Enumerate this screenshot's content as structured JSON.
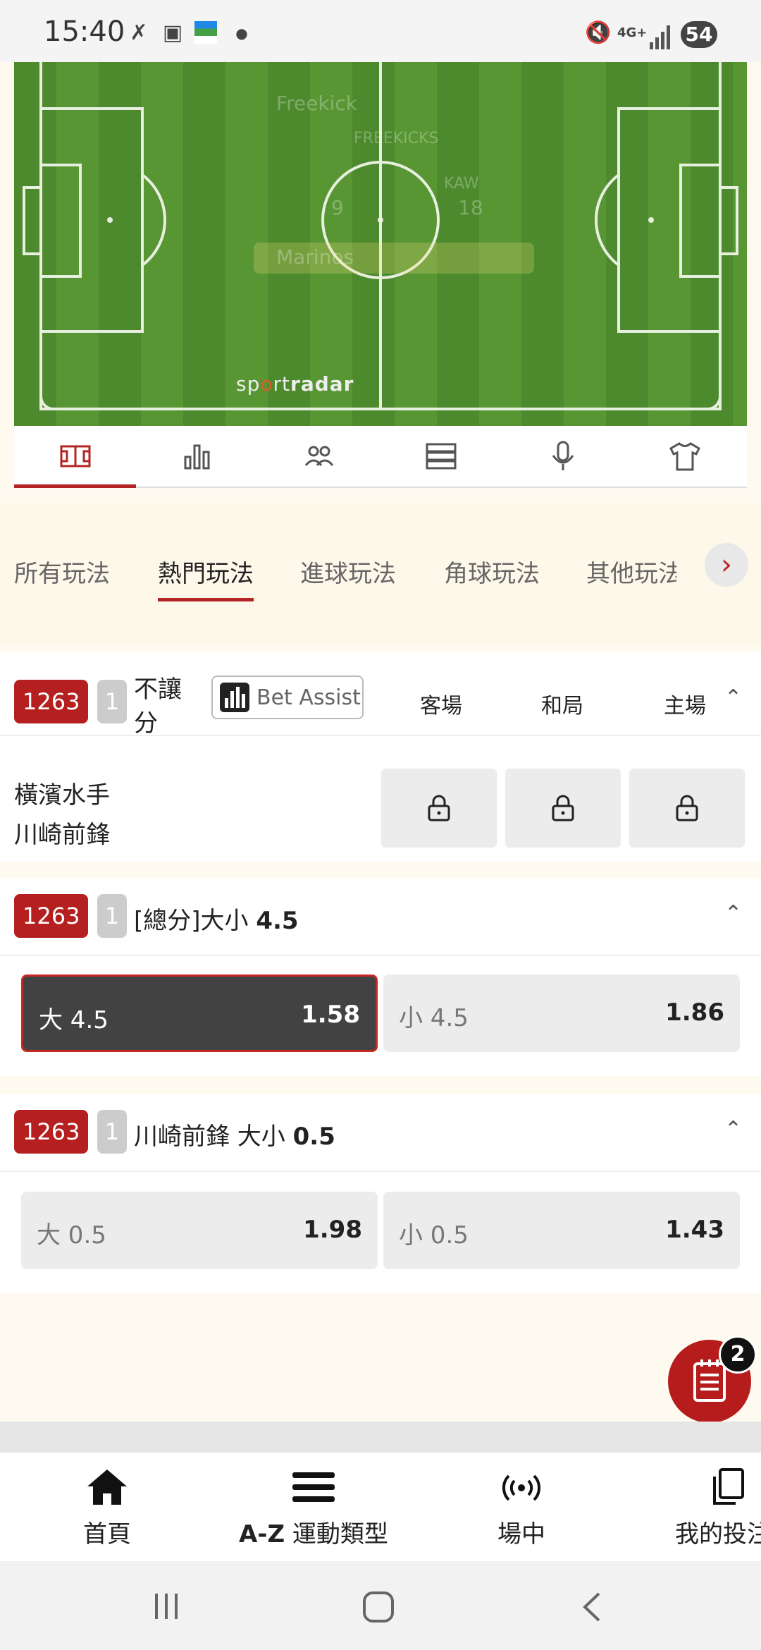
{
  "status_bar": {
    "time": "15:40",
    "battery": "54",
    "network": "4G+"
  },
  "pitch": {
    "brand_prefix": "sp",
    "brand_mid": "rt",
    "brand_bold": "radar",
    "ghost_text_1": "Freekick",
    "ghost_text_2": "FREEKICKS",
    "ghost_score_home": "9",
    "ghost_team_code": "KAW",
    "ghost_score_away": "18",
    "ghost_team_name": "Marinos"
  },
  "icon_tabs": [
    "pitch-icon",
    "stats-icon",
    "lineup-icon",
    "list-icon",
    "commentary-icon",
    "jersey-icon"
  ],
  "market_tabs": [
    "所有玩法",
    "熱門玩法",
    "進球玩法",
    "角球玩法",
    "其他玩法"
  ],
  "markets": {
    "m1": {
      "id": "1263",
      "num": "1",
      "title_line1": "不讓",
      "title_line2": "分",
      "bet_assist": "Bet Assist",
      "col_away": "客場",
      "col_draw": "和局",
      "col_home": "主場",
      "team1": "橫濱水手",
      "team2": "川崎前鋒"
    },
    "m2": {
      "id": "1263",
      "num": "1",
      "title": "[總分]大小",
      "line": "4.5",
      "over_label": "大 4.5",
      "over_odds": "1.58",
      "under_label": "小 4.5",
      "under_odds": "1.86"
    },
    "m3": {
      "id": "1263",
      "num": "1",
      "title": "川崎前鋒 大小",
      "line": "0.5",
      "over_label": "大 0.5",
      "over_odds": "1.98",
      "under_label": "小 0.5",
      "under_odds": "1.43"
    }
  },
  "bet_slip": {
    "count": "2"
  },
  "bottom_nav": {
    "home": "首頁",
    "az_prefix": "A-Z",
    "az": " 運動類型",
    "live": "場中",
    "mybets": "我的投注"
  },
  "colors": {
    "accent": "#b51f1f",
    "pitch_green": "#4f8a2e"
  }
}
